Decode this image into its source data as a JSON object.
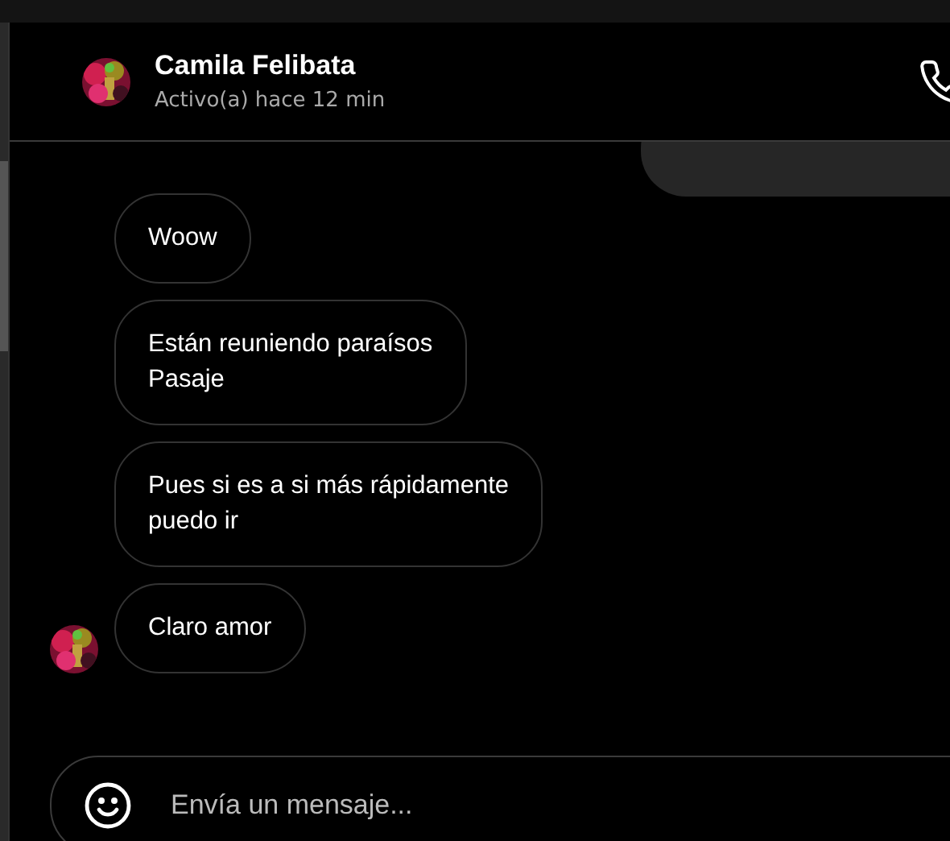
{
  "contact": {
    "name": "Camila Felibata",
    "status": "Activo(a) hace 12 min"
  },
  "messages": [
    {
      "text": "Woow",
      "show_avatar": false
    },
    {
      "text": "Están reuniendo paraísos\nPasaje",
      "show_avatar": false
    },
    {
      "text": "Pues si es a si más rápidamente\npuedo ir",
      "show_avatar": false
    },
    {
      "text": "Claro amor",
      "show_avatar": true
    }
  ],
  "composer": {
    "placeholder": "Envía un mensaje..."
  }
}
